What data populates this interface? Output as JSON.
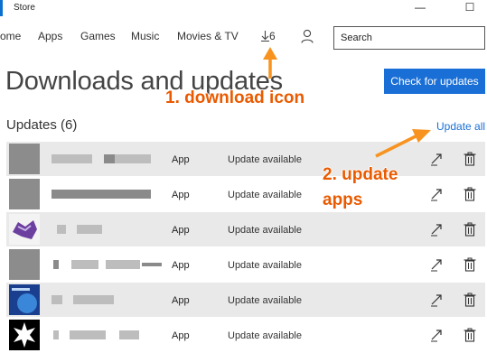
{
  "window": {
    "title": "Store",
    "minimize": "—",
    "maximize": "☐"
  },
  "nav": {
    "home": "ome",
    "apps": "Apps",
    "games": "Games",
    "music": "Music",
    "movies": "Movies & TV",
    "downloads_count": "6"
  },
  "search": {
    "placeholder": "Search"
  },
  "page": {
    "title": "Downloads and updates",
    "check_button": "Check for updates",
    "updates_header": "Updates (6)",
    "update_all": "Update all"
  },
  "rows": [
    {
      "kind": "App",
      "status": "Update available",
      "icon": "gray-square"
    },
    {
      "kind": "App",
      "status": "Update available",
      "icon": "gray-square"
    },
    {
      "kind": "App",
      "status": "Update available",
      "icon": "purple-app-icon"
    },
    {
      "kind": "App",
      "status": "Update available",
      "icon": "gray-square"
    },
    {
      "kind": "App",
      "status": "Update available",
      "icon": "blue-app-icon"
    },
    {
      "kind": "App",
      "status": "Update available",
      "icon": "black-white-burst-icon"
    }
  ],
  "annotations": {
    "callout1": "1. download icon",
    "callout2_line1": "2. update",
    "callout2_line2": "apps"
  },
  "colors": {
    "accent": "#1a6fd6",
    "annotation": "#ea5a00",
    "row_alt": "#e9e9e9"
  }
}
